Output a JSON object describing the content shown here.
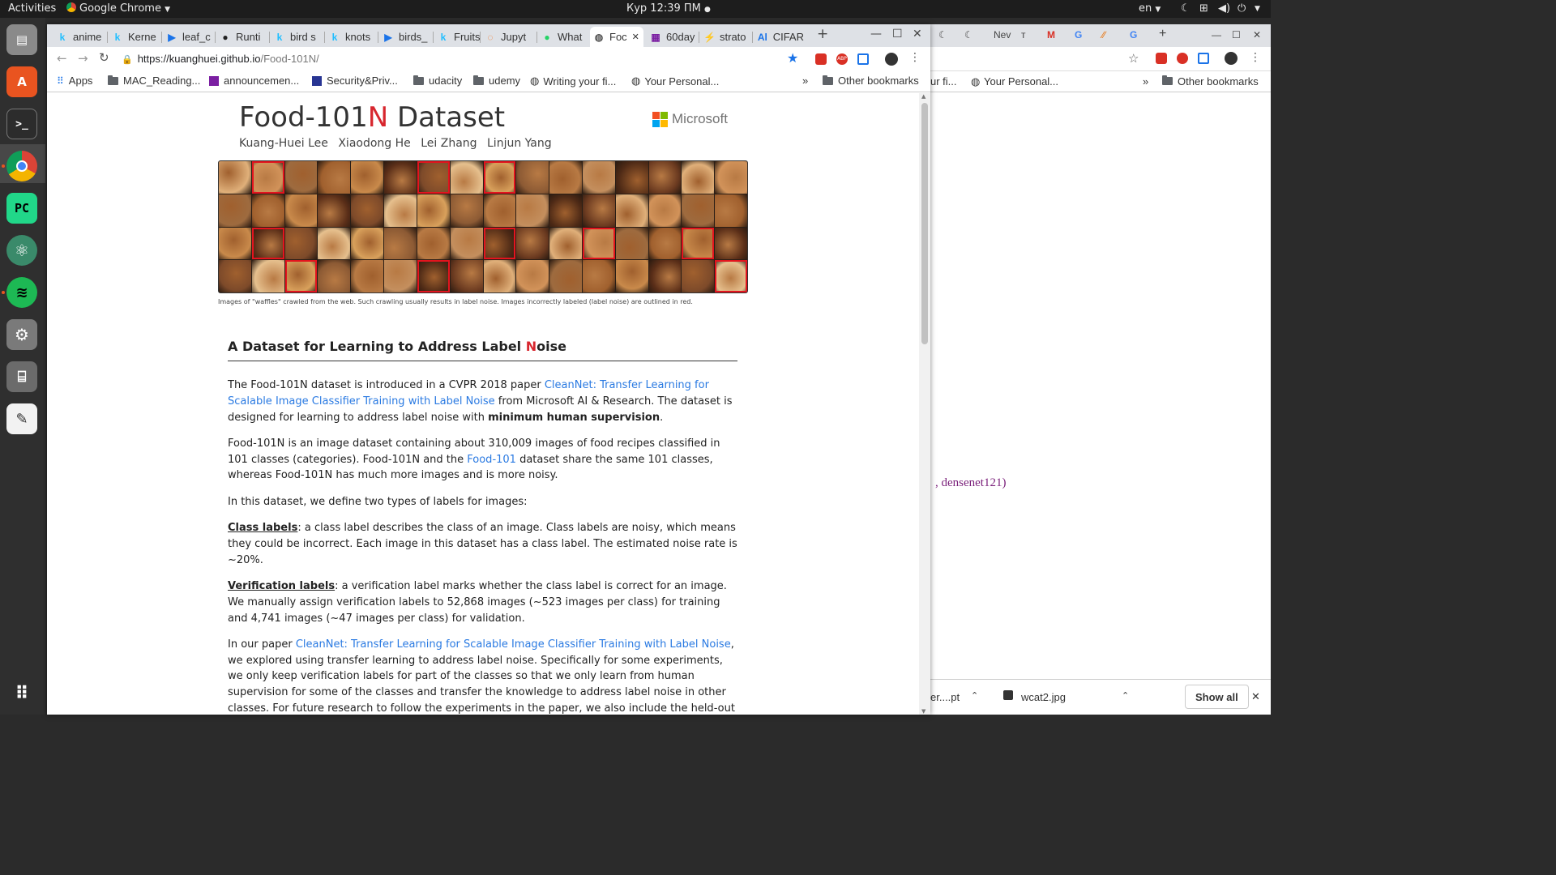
{
  "topbar": {
    "activities": "Activities",
    "app_menu": "Google Chrome",
    "clock": "Кур 12:39 ПМ",
    "lang": "en"
  },
  "browser": {
    "tabs": [
      {
        "icon": "k",
        "label": "anime"
      },
      {
        "icon": "k",
        "label": "Kerne"
      },
      {
        "icon": "▶",
        "label": "leaf_c"
      },
      {
        "icon": "●",
        "label": "Runti"
      },
      {
        "icon": "k",
        "label": "bird s"
      },
      {
        "icon": "k",
        "label": "knots"
      },
      {
        "icon": "▶",
        "label": "birds_"
      },
      {
        "icon": "k",
        "label": "Fruits"
      },
      {
        "icon": "◌",
        "label": "Jupyt"
      },
      {
        "icon": "●",
        "label": "What"
      },
      {
        "icon": "◍",
        "label": "Foc",
        "active": true
      },
      {
        "icon": "▦",
        "label": "60day"
      },
      {
        "icon": "⚡",
        "label": "strato"
      },
      {
        "icon": "Al",
        "label": "CIFAR"
      }
    ],
    "url_host": "https://kuanghuei.github.io",
    "url_path": "/Food-101N/",
    "bookmarks": {
      "apps": "Apps",
      "items": [
        "MAC_Reading...",
        "announcemen...",
        "Security&Priv...",
        "udacity",
        "udemy",
        "Writing your fi...",
        "Your Personal..."
      ],
      "overflow": "»",
      "other": "Other bookmarks"
    }
  },
  "bg_window": {
    "tabs": [
      "Nev"
    ],
    "bookmarks": [
      "ur fi...",
      "Your Personal...",
      "»",
      "Other bookmarks"
    ],
    "code_text": ", densenet121)",
    "downloads": {
      "item1": "er....pt",
      "item2": "wcat2.jpg",
      "show_all": "Show all"
    }
  },
  "page": {
    "title_pre": "Food-101",
    "title_red": "N",
    "title_post": " Dataset",
    "authors": [
      "Kuang-Huei Lee",
      "Xiaodong He",
      "Lei Zhang",
      "Linjun Yang"
    ],
    "brand": "Microsoft",
    "brand_colors": [
      "#f25022",
      "#7fba00",
      "#00a4ef",
      "#ffb900"
    ],
    "mosaic_noisy_cells": [
      1,
      6,
      8,
      33,
      40,
      43,
      46,
      50,
      54,
      63
    ],
    "caption": "Images of \"waffles\" crawled from the web. Such crawling usually results in label noise. Images incorrectly labeled (label noise) are outlined in red.",
    "section_title_pre": "A Dataset for Learning to Address Label ",
    "section_title_red": "N",
    "section_title_post": "oise",
    "p1_a": "The Food-101N dataset is introduced in a CVPR 2018 paper ",
    "p1_link": "CleanNet: Transfer Learning for Scalable Image Classifier Training with Label Noise",
    "p1_b": " from Microsoft AI & Research. The dataset is designed for learning to address label noise with ",
    "p1_bold": "minimum human supervision",
    "p1_c": ".",
    "p2_a": "Food-101N is an image dataset containing about 310,009 images of food recipes classified in 101 classes (categories). Food-101N and the ",
    "p2_link": "Food-101",
    "p2_b": " dataset share the same 101 classes, whereas Food-101N has much more images and is more noisy.",
    "p3": "In this dataset, we define two types of labels for images:",
    "p4_label": "Class labels",
    "p4_text": ": a class label describes the class of an image. Class labels are noisy, which means they could be incorrect. Each image in this dataset has a class label. The estimated noise rate is ~20%.",
    "p5_label": "Verification labels",
    "p5_text": ": a verification label marks whether the class label is correct for an image. We manually assign verification labels to 52,868 images (~523 images per class) for training and 4,741 images (~47 images per class) for validation.",
    "p6_a": "In our paper ",
    "p6_link": "CleanNet: Transfer Learning for Scalable Image Classifier Training with Label Noise",
    "p6_b": ", we explored using transfer learning to address label noise. Specifically for some experiments, we only keep verification labels for part of the classes so that we only learn from human supervision for some of the classes and transfer the knowledge to address label noise in other classes. For future research to follow the experiments in the paper, we also include the held-out class lists in this dataset."
  }
}
